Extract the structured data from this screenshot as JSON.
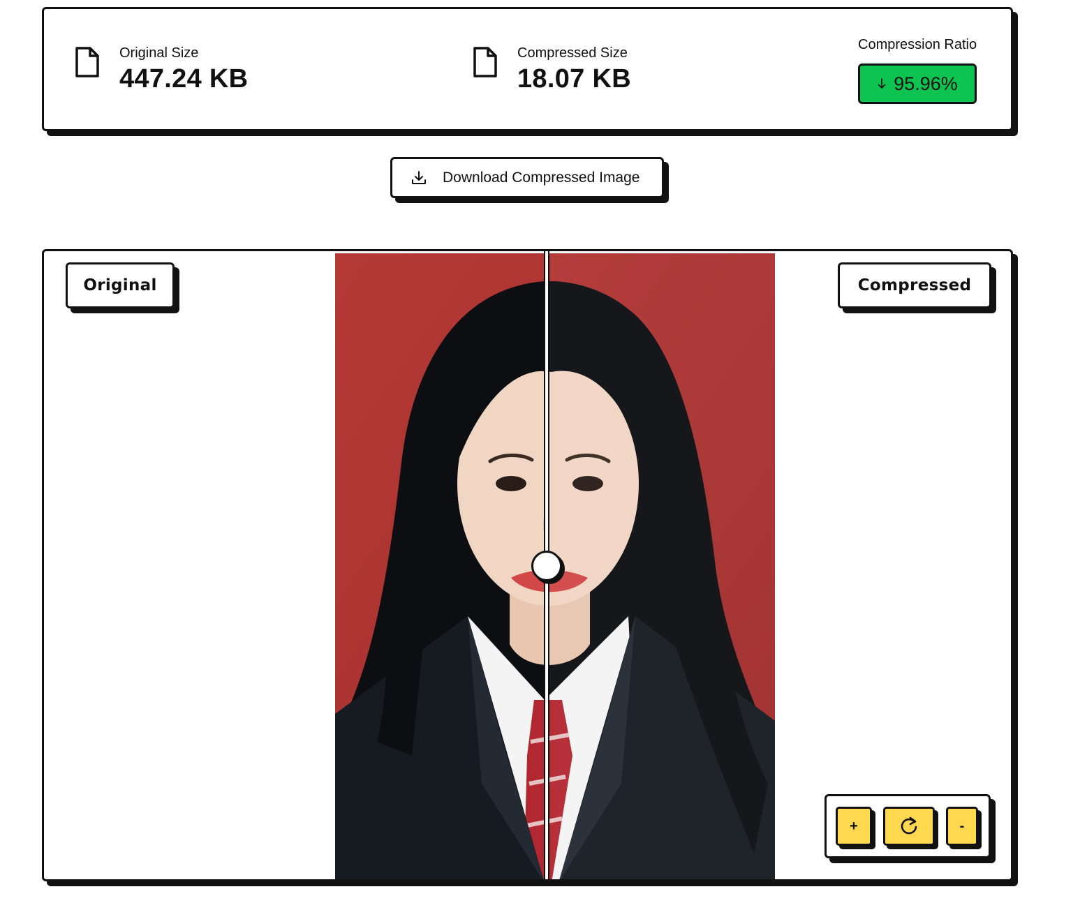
{
  "stats": {
    "original": {
      "label": "Original Size",
      "value": "447.24 KB",
      "icon": "file-icon"
    },
    "compressed": {
      "label": "Compressed Size",
      "value": "18.07 KB",
      "icon": "file-icon"
    },
    "ratio": {
      "label": "Compression Ratio",
      "value": "95.96%",
      "icon": "arrow-down-icon",
      "color": "#0ec451"
    }
  },
  "actions": {
    "download_label": "Download Compressed Image",
    "download_icon": "download-icon"
  },
  "viewer": {
    "left_tag": "Original",
    "right_tag": "Compressed",
    "slider_position": 0.485,
    "zoom_in_label": "+",
    "zoom_out_label": "-",
    "reset_icon": "rotate-cw-icon",
    "zoom_button_color": "#fed94f",
    "photo_background_color": "#b03434"
  }
}
